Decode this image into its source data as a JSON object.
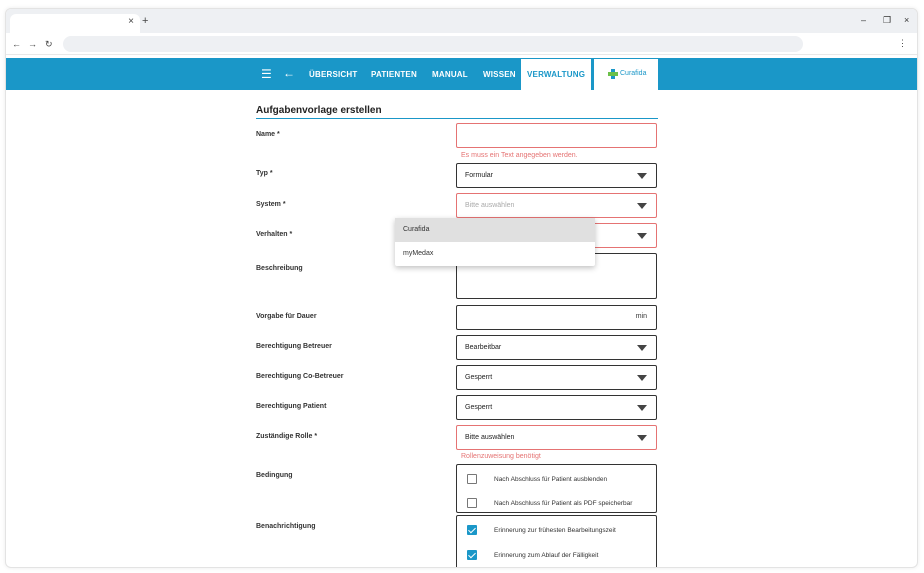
{
  "browser": {
    "tab_close": "×",
    "new_tab": "+",
    "minimize": "–",
    "restore": "❐",
    "close": "×",
    "back": "←",
    "forward": "→",
    "reload": "↻",
    "menu": "⋮"
  },
  "header": {
    "menu_icon": "☰",
    "back_icon": "←",
    "nav": [
      "ÜBERSICHT",
      "PATIENTEN",
      "MANUAL",
      "WISSEN",
      "VERWALTUNG"
    ],
    "active": "VERWALTUNG",
    "logo_text": "Curafida"
  },
  "form": {
    "title": "Aufgabenvorlage erstellen",
    "name": {
      "label": "Name *",
      "value": "",
      "error": "Es muss ein Text angegeben werden."
    },
    "typ": {
      "label": "Typ *",
      "value": "Formular"
    },
    "system": {
      "label": "System *",
      "placeholder": "Bitte auswählen"
    },
    "verhalten": {
      "label": "Verhalten *"
    },
    "beschreibung": {
      "label": "Beschreibung"
    },
    "dauer": {
      "label": "Vorgabe für Dauer",
      "unit": "min"
    },
    "betreuer": {
      "label": "Berechtigung Betreuer",
      "value": "Bearbeitbar"
    },
    "co_betreuer": {
      "label": "Berechtigung Co-Betreuer",
      "value": "Gesperrt"
    },
    "patient": {
      "label": "Berechtigung Patient",
      "value": "Gesperrt"
    },
    "rolle": {
      "label": "Zuständige Rolle *",
      "value": "Bitte auswählen",
      "error": "Rollenzuweisung benötigt"
    },
    "bedingung": {
      "label": "Bedingung",
      "options": [
        {
          "text": "Nach Abschluss für Patient ausblenden",
          "checked": false
        },
        {
          "text": "Nach Abschluss für Patient als PDF speicherbar",
          "checked": false
        }
      ]
    },
    "benachrichtigung": {
      "label": "Benachrichtigung",
      "options": [
        {
          "text": "Erinnerung zur frühesten Bearbeitungszeit",
          "checked": true
        },
        {
          "text": "Erinnerung zum Ablauf der Fälligkeit",
          "checked": true
        }
      ]
    }
  },
  "dropdown": {
    "items": [
      "Curafida",
      "myMedax"
    ],
    "highlighted": "Curafida"
  },
  "colors": {
    "primary": "#1a97c8",
    "error": "#e57373",
    "logo_green": "#6cc04a"
  }
}
